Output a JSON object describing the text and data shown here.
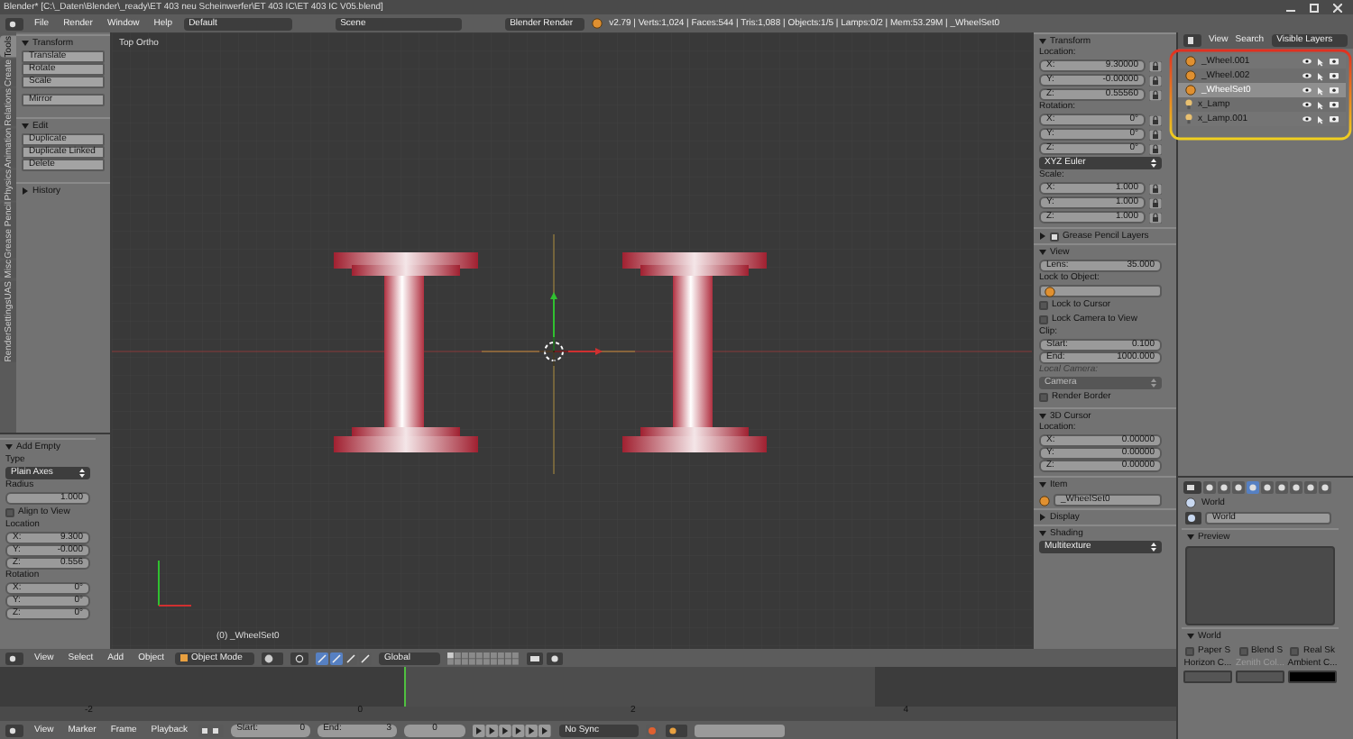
{
  "window": {
    "title": "Blender* [C:\\_Daten\\Blender\\_ready\\ET 403 neu Scheinwerfer\\ET 403 IC\\ET 403 IC V05.blend]"
  },
  "info_header": {
    "menus": [
      "File",
      "Render",
      "Window",
      "Help"
    ],
    "layout": "Default",
    "scene": "Scene",
    "engine": "Blender Render",
    "stats": "v2.79 | Verts:1,024 | Faces:544 | Tris:1,088 | Objects:1/5 | Lamps:0/2 | Mem:53.29M | _WheelSet0"
  },
  "tool_tabs": [
    {
      "label": "Tools",
      "selected": true
    },
    {
      "label": "Create",
      "selected": false
    },
    {
      "label": "Relations",
      "selected": false
    },
    {
      "label": "Animation",
      "selected": false
    },
    {
      "label": "Physics",
      "selected": false
    },
    {
      "label": "Grease Pencil",
      "selected": false
    },
    {
      "label": "Misc",
      "selected": false
    },
    {
      "label": "RenderSettingsUAS",
      "selected": false
    }
  ],
  "tool_sections": [
    {
      "title": "Transform",
      "expanded": true,
      "groups": [
        [
          "Translate",
          "Rotate",
          "Scale"
        ],
        [
          "Mirror"
        ]
      ]
    },
    {
      "title": "Edit",
      "expanded": true,
      "groups": [
        [
          "Duplicate",
          "Duplicate Linked",
          "Delete"
        ]
      ]
    },
    {
      "title": "History",
      "expanded": false
    }
  ],
  "operator_panel": {
    "title": "Add Empty",
    "expanded": true,
    "type_label": "Type",
    "type": "Plain Axes",
    "radius_label": "Radius",
    "radius": "1.000",
    "align_to_view": {
      "label": "Align to View",
      "checked": false
    },
    "location_label": "Location",
    "location": [
      {
        "axis": "X:",
        "value": "9.300"
      },
      {
        "axis": "Y:",
        "value": "-0.000"
      },
      {
        "axis": "Z:",
        "value": "0.556"
      }
    ],
    "rotation_label": "Rotation",
    "rotation": [
      {
        "axis": "X:",
        "value": "0°"
      },
      {
        "axis": "Y:",
        "value": "0°"
      },
      {
        "axis": "Z:",
        "value": "0°"
      }
    ]
  },
  "viewport": {
    "view_name": "Top Ortho",
    "object_label": "(0) _WheelSet0"
  },
  "n_panel": {
    "transform": {
      "title": "Transform",
      "expanded": true,
      "location_label": "Location:",
      "location": [
        {
          "axis": "X:",
          "value": "9.30000"
        },
        {
          "axis": "Y:",
          "value": "-0.00000"
        },
        {
          "axis": "Z:",
          "value": "0.55560"
        }
      ],
      "rotation_label": "Rotation:",
      "rotation": [
        {
          "axis": "X:",
          "value": "0°"
        },
        {
          "axis": "Y:",
          "value": "0°"
        },
        {
          "axis": "Z:",
          "value": "0°"
        }
      ],
      "rotation_mode": "XYZ Euler",
      "scale_label": "Scale:",
      "scale": [
        {
          "axis": "X:",
          "value": "1.000"
        },
        {
          "axis": "Y:",
          "value": "1.000"
        },
        {
          "axis": "Z:",
          "value": "1.000"
        }
      ]
    },
    "grease_pencil": {
      "title": "Grease Pencil Layers",
      "checked": true,
      "expanded": false
    },
    "view": {
      "title": "View",
      "expanded": true,
      "lens_label": "Lens:",
      "lens": "35.000",
      "lock_object_label": "Lock to Object:",
      "lock_cursor": {
        "label": "Lock to Cursor",
        "checked": false
      },
      "lock_camera": {
        "label": "Lock Camera to View",
        "checked": false
      },
      "clip_label": "Clip:",
      "clip_start_label": "Start:",
      "clip_start": "0.100",
      "clip_end_label": "End:",
      "clip_end": "1000.000",
      "local_camera_label": "Local Camera:",
      "local_camera": "Camera",
      "render_border": {
        "label": "Render Border",
        "checked": false
      }
    },
    "cursor": {
      "title": "3D Cursor",
      "expanded": true,
      "location_label": "Location:",
      "location": [
        {
          "axis": "X:",
          "value": "0.00000"
        },
        {
          "axis": "Y:",
          "value": "0.00000"
        },
        {
          "axis": "Z:",
          "value": "0.00000"
        }
      ]
    },
    "item": {
      "title": "Item",
      "expanded": true,
      "name": "_WheelSet0"
    },
    "display": {
      "title": "Display",
      "expanded": false
    },
    "shading": {
      "title": "Shading",
      "expanded": true,
      "mode": "Multitexture"
    }
  },
  "outliner": {
    "menus": [
      "View",
      "Search"
    ],
    "display_mode": "Visible Layers",
    "items": [
      {
        "name": "_Wheel.001",
        "kind": "empty",
        "selected": false
      },
      {
        "name": "_Wheel.002",
        "kind": "empty",
        "selected": false
      },
      {
        "name": "_WheelSet0",
        "kind": "empty",
        "selected": true
      },
      {
        "name": "x_Lamp",
        "kind": "lamp",
        "selected": false
      },
      {
        "name": "x_Lamp.001",
        "kind": "lamp",
        "selected": false
      }
    ]
  },
  "properties": {
    "context": "World",
    "world": "World",
    "preview_title": "Preview",
    "world_title": "World",
    "options": [
      {
        "label": "Paper S",
        "checked": false
      },
      {
        "label": "Blend S",
        "checked": false
      },
      {
        "label": "Real Sk",
        "checked": false
      }
    ],
    "colors": [
      {
        "label": "Horizon C...",
        "color": "#555555",
        "disabled": false
      },
      {
        "label": "Zenith Col...",
        "color": "#555555",
        "disabled": true
      },
      {
        "label": "Ambient C...",
        "color": "#000000",
        "disabled": false
      }
    ]
  },
  "view3d_header": {
    "menus": [
      "View",
      "Select",
      "Add",
      "Object"
    ],
    "mode": "Object Mode",
    "orientation": "Global"
  },
  "timeline": {
    "ticks": [
      "-2",
      "0",
      "2",
      "4"
    ]
  },
  "timeline_header": {
    "menus": [
      "View",
      "Marker",
      "Frame",
      "Playback"
    ],
    "start_label": "Start:",
    "start": "0",
    "end_label": "End:",
    "end": "3",
    "current": "0",
    "sync": "No Sync"
  }
}
